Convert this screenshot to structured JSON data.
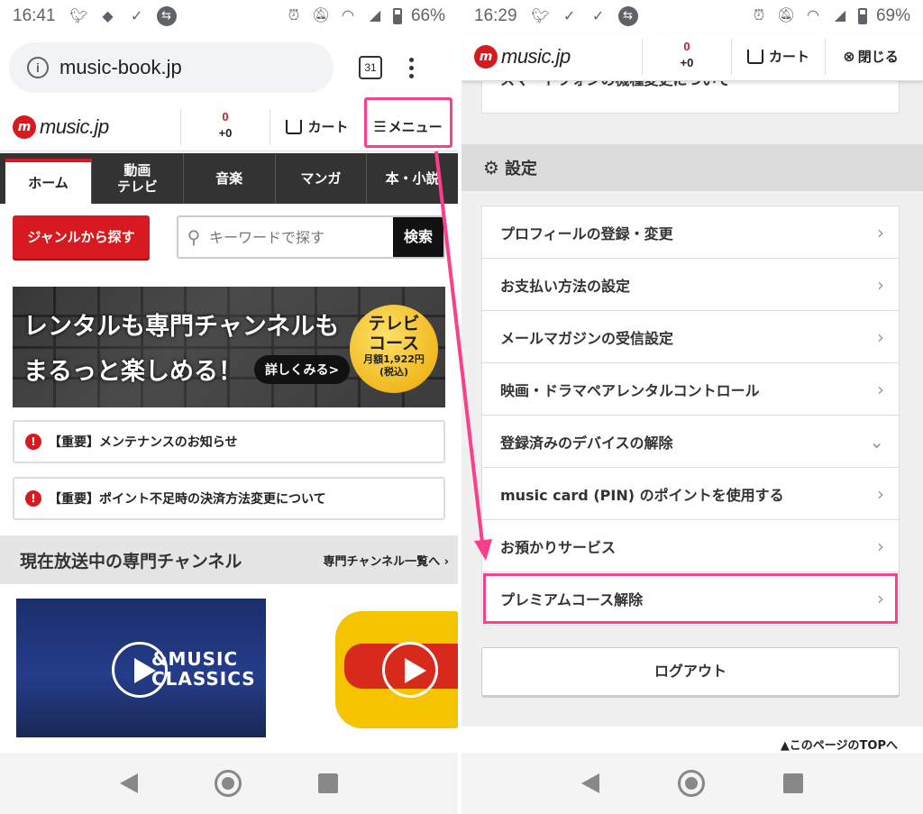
{
  "left": {
    "status": {
      "time": "16:41",
      "battery": "66%"
    },
    "url": "music-book.jp",
    "tab_count": "31",
    "header": {
      "logo": "music.jp",
      "points_top": "0",
      "points_bottom": "+0",
      "cart": "カート",
      "menu": "メニュー"
    },
    "nav": [
      {
        "label": "ホーム"
      },
      {
        "label": "動画\nテレビ"
      },
      {
        "label": "音楽"
      },
      {
        "label": "マンガ"
      },
      {
        "label": "本・小説"
      }
    ],
    "genre_button": "ジャンルから探す",
    "search": {
      "placeholder": "キーワードで探す",
      "button": "検索"
    },
    "banner": {
      "line1": "レンタルも専門チャンネルも",
      "line2": "まるっと楽しめる！",
      "more": "詳しくみる>",
      "badge_title": "テレビ\nコース",
      "badge_price": "月額1,922円",
      "badge_tax": "(税込)"
    },
    "notices": [
      "【重要】メンテナンスのお知らせ",
      "【重要】ポイント不足時の決済方法変更について"
    ],
    "section": {
      "title": "現在放送中の専門チャンネル",
      "link": "専門チャンネル一覧へ"
    },
    "channel1_logo": "&MUSIC\nCLASSICS"
  },
  "right": {
    "status": {
      "time": "16:29",
      "battery": "69%"
    },
    "header": {
      "logo": "music.jp",
      "points_top": "0",
      "points_bottom": "+0",
      "cart": "カート",
      "close": "閉じる"
    },
    "prev_item": "スマートフォンの機種変更について",
    "settings_title": "設定",
    "menu": [
      {
        "label": "プロフィールの登録・変更",
        "chevron": "›"
      },
      {
        "label": "お支払い方法の設定",
        "chevron": "›"
      },
      {
        "label": "メールマガジンの受信設定",
        "chevron": "›"
      },
      {
        "label": "映画・ドラマペアレンタルコントロール",
        "chevron": "›"
      },
      {
        "label": "登録済みのデバイスの解除",
        "chevron": "⌄"
      },
      {
        "label": "music card (PIN) のポイントを使用する",
        "chevron": "›"
      },
      {
        "label": "お預かりサービス",
        "chevron": "›"
      },
      {
        "label": "プレミアムコース解除",
        "chevron": "›"
      }
    ],
    "logout": "ログアウト",
    "page_top": "▲このページのTOPへ"
  },
  "colors": {
    "brand_red": "#d71a20",
    "highlight_pink": "#ff3d8b",
    "nav_dark": "#333333"
  }
}
